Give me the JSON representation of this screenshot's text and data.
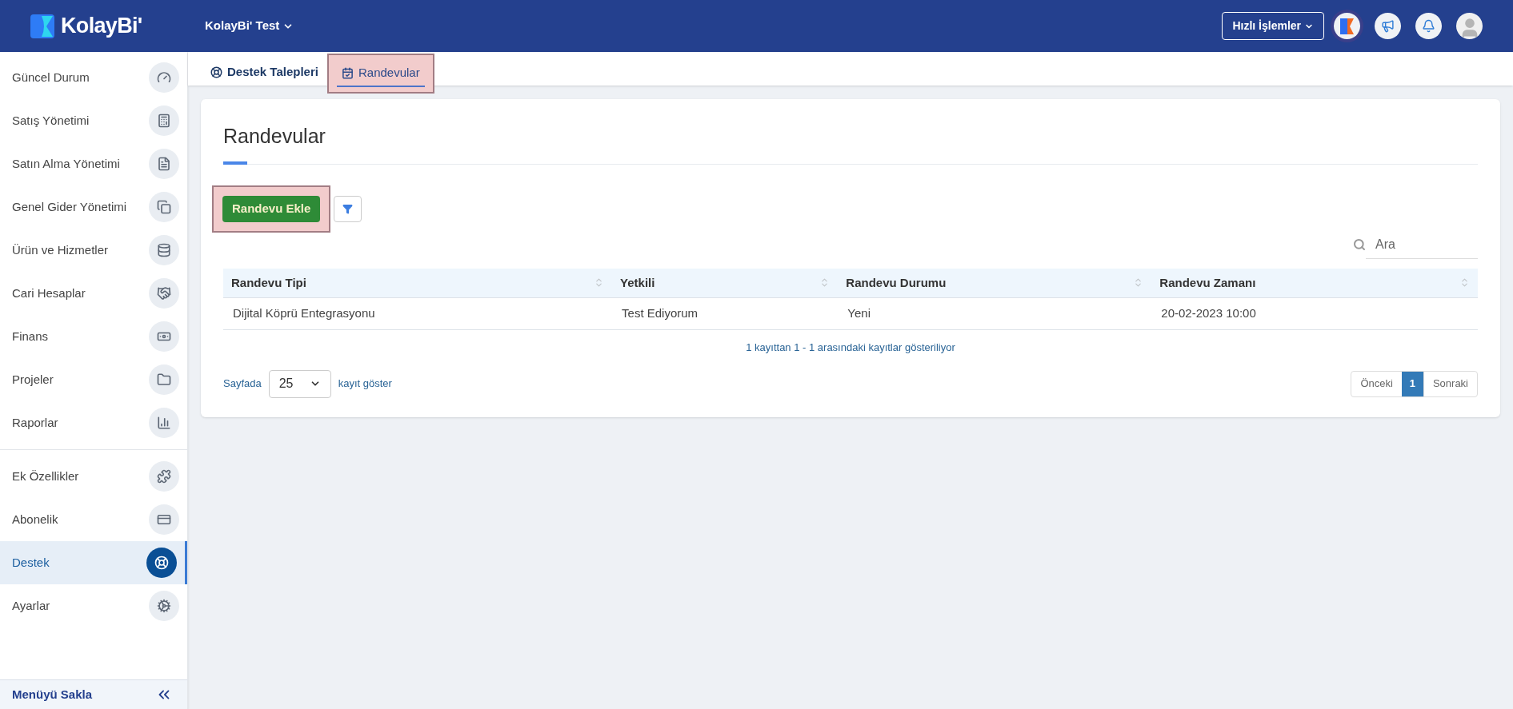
{
  "header": {
    "logo": "KolayBi'",
    "company": "KolayBi' Test",
    "quick_actions": "Hızlı İşlemler"
  },
  "sidebar": {
    "sections": [
      {
        "items": [
          {
            "label": "Güncel Durum",
            "selected": false
          },
          {
            "label": "Satış Yönetimi",
            "selected": false
          },
          {
            "label": "Satın Alma Yönetimi",
            "selected": false
          },
          {
            "label": "Genel Gider Yönetimi",
            "selected": false
          },
          {
            "label": "Ürün ve Hizmetler",
            "selected": false
          },
          {
            "label": "Cari Hesaplar",
            "selected": false
          },
          {
            "label": "Finans",
            "selected": false
          },
          {
            "label": "Projeler",
            "selected": false
          },
          {
            "label": "Raporlar",
            "selected": false
          }
        ]
      },
      {
        "items": [
          {
            "label": "Ek Özellikler",
            "selected": false
          },
          {
            "label": "Abonelik",
            "selected": false
          },
          {
            "label": "Destek",
            "selected": true
          },
          {
            "label": "Ayarlar",
            "selected": false
          }
        ]
      }
    ],
    "hide_menu": "Menüyü Sakla"
  },
  "tabs": [
    {
      "label": "Destek Talepleri",
      "selected": false,
      "highlighted": false
    },
    {
      "label": "Randevular",
      "selected": true,
      "highlighted": true
    }
  ],
  "page": {
    "title": "Randevular",
    "add_button": {
      "label": "Randevu Ekle",
      "highlighted": true
    },
    "search": {
      "placeholder": "Ara"
    }
  },
  "table": {
    "columns": [
      "Randevu Tipi",
      "Yetkili",
      "Randevu Durumu",
      "Randevu Zamanı"
    ],
    "rows": [
      [
        "Dijital Köprü Entegrasyonu",
        "Test Ediyorum",
        "Yeni",
        "20-02-2023 10:00"
      ]
    ],
    "info": "1 kayıttan 1 - 1 arasındaki kayıtlar gösteriliyor"
  },
  "page_size": {
    "before": "Sayfada",
    "value": "25",
    "after": "kayıt göster"
  },
  "pagination": {
    "previous": "Önceki",
    "pages": [
      {
        "label": "1",
        "selected": true
      }
    ],
    "next": "Sonraki"
  }
}
